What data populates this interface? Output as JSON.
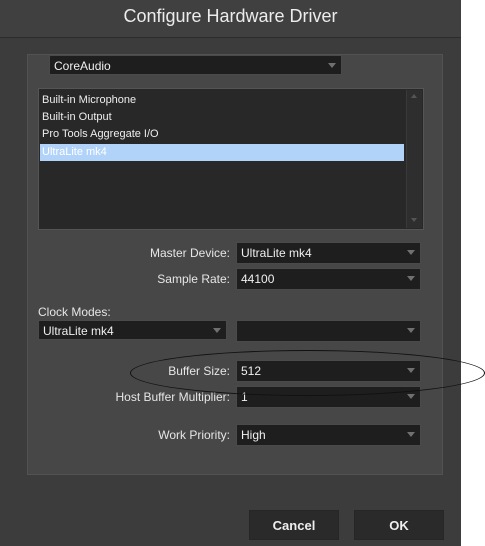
{
  "dialog": {
    "title": "Configure Hardware Driver"
  },
  "driver_select": {
    "value": "CoreAudio"
  },
  "device_list": {
    "items": [
      {
        "label": "Built-in Microphone",
        "selected": false
      },
      {
        "label": "Built-in Output",
        "selected": false
      },
      {
        "label": "Pro Tools Aggregate I/O",
        "selected": false
      },
      {
        "label": "UltraLite mk4",
        "selected": true
      }
    ]
  },
  "master_device": {
    "label": "Master Device:",
    "value": "UltraLite mk4"
  },
  "sample_rate": {
    "label": "Sample Rate:",
    "value": "44100"
  },
  "clock_modes": {
    "label": "Clock Modes:",
    "source": "UltraLite mk4",
    "mode": ""
  },
  "buffer_size": {
    "label": "Buffer Size:",
    "value": "512"
  },
  "host_buffer_multiplier": {
    "label": "Host Buffer Multiplier:",
    "value": "1"
  },
  "work_priority": {
    "label": "Work Priority:",
    "value": "High"
  },
  "buttons": {
    "cancel": "Cancel",
    "ok": "OK"
  },
  "colors": {
    "dialog_bg": "#3c3c3c",
    "panel_bg": "#474747",
    "selection": "#b2d3f9",
    "field_bg": "#1e1e1e"
  }
}
